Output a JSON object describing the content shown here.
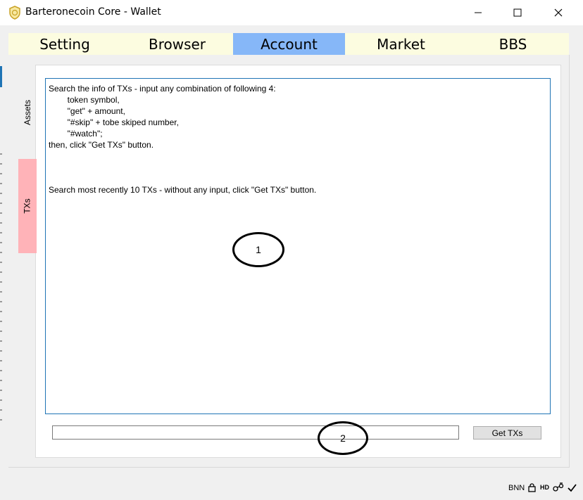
{
  "window": {
    "title": "Barteronecoin Core - Wallet",
    "icons": {
      "app": "shield-coin-icon",
      "minimize": "minimize-icon",
      "maximize": "maximize-icon",
      "close": "close-icon"
    }
  },
  "tabs": [
    {
      "label": "Setting",
      "active": false
    },
    {
      "label": "Browser",
      "active": false
    },
    {
      "label": "Account",
      "active": true
    },
    {
      "label": "Market",
      "active": false
    },
    {
      "label": "BBS",
      "active": false
    }
  ],
  "colors": {
    "tabbar_bg": "#fcfce0",
    "tab_active": "#86b7f8",
    "txs_tab": "#ffb3b8",
    "textarea_border": "#1f74b5"
  },
  "side_tabs": [
    {
      "label": "Assets",
      "active": false
    },
    {
      "label": "TXs",
      "active": true
    }
  ],
  "help_text": "Search the info of TXs - input any combination of following 4:\n        token symbol,\n        \"get\" + amount,\n        \"#skip\" + tobe skiped number,\n        \"#watch\";\nthen, click \"Get TXs\" button.\n\n\n\nSearch most recently 10 TXs - without any input, click \"Get TXs\" button.",
  "annotations": {
    "first": "1",
    "second": "2"
  },
  "search": {
    "value": "",
    "placeholder": ""
  },
  "get_button_label": "Get TXs",
  "status": {
    "unit": "BNN",
    "icons": [
      "lock-icon",
      "hd-icon",
      "network-icon",
      "sync-check-icon"
    ],
    "hd_label": "HD"
  }
}
